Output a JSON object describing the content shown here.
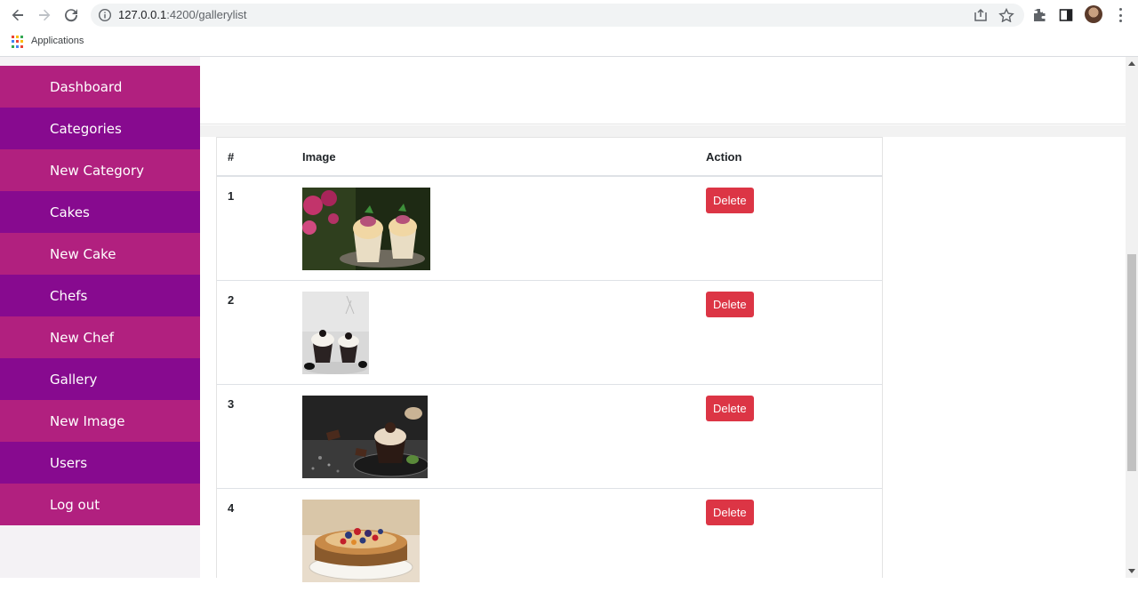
{
  "browser": {
    "url_host": "127.0.0.1",
    "url_rest": ":4200/gallerylist",
    "bookmark_apps": "Applications"
  },
  "sidebar": {
    "items": [
      {
        "label": "Dashboard"
      },
      {
        "label": "Categories"
      },
      {
        "label": "New Category"
      },
      {
        "label": "Cakes"
      },
      {
        "label": "New Cake"
      },
      {
        "label": "Chefs"
      },
      {
        "label": "New Chef"
      },
      {
        "label": "Gallery"
      },
      {
        "label": "New Image"
      },
      {
        "label": "Users"
      },
      {
        "label": "Log out"
      }
    ]
  },
  "table": {
    "headers": {
      "num": "#",
      "image": "Image",
      "action": "Action"
    },
    "rows": [
      {
        "num": "1",
        "image": "cupcakes-with-flowers",
        "action": "Delete"
      },
      {
        "num": "2",
        "image": "chocolate-cupcakes-white",
        "action": "Delete"
      },
      {
        "num": "3",
        "image": "chocolate-cupcake-dark",
        "action": "Delete"
      },
      {
        "num": "4",
        "image": "berry-pancake-cake",
        "action": "Delete"
      }
    ]
  },
  "colors": {
    "menu_odd": "#b1207f",
    "menu_even": "#870a8f",
    "delete_button": "#dc3545"
  }
}
